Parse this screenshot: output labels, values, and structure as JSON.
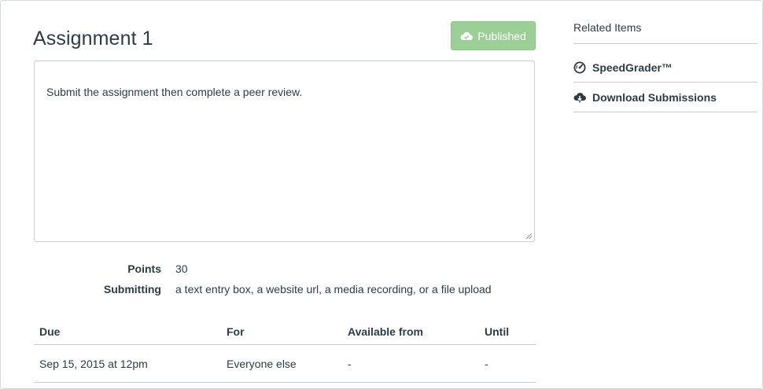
{
  "assignment": {
    "title": "Assignment 1",
    "publish_label": "Published",
    "description": "Submit the assignment then complete a peer review."
  },
  "details": [
    {
      "label": "Points",
      "value": "30"
    },
    {
      "label": "Submitting",
      "value": "a text entry box, a website url, a media recording, or a file upload"
    }
  ],
  "due_table": {
    "headers": [
      "Due",
      "For",
      "Available from",
      "Until"
    ],
    "rows": [
      [
        "Sep 15, 2015 at 12pm",
        "Everyone else",
        "-",
        "-"
      ]
    ]
  },
  "sidebar": {
    "title": "Related Items",
    "items": [
      {
        "label": "SpeedGrader™",
        "icon": "speedgrader-icon"
      },
      {
        "label": "Download Submissions",
        "icon": "cloud-download-icon"
      }
    ]
  },
  "colors": {
    "published_bg": "#9ccf96",
    "text": "#2d3b45",
    "border": "#c7cdd1"
  }
}
